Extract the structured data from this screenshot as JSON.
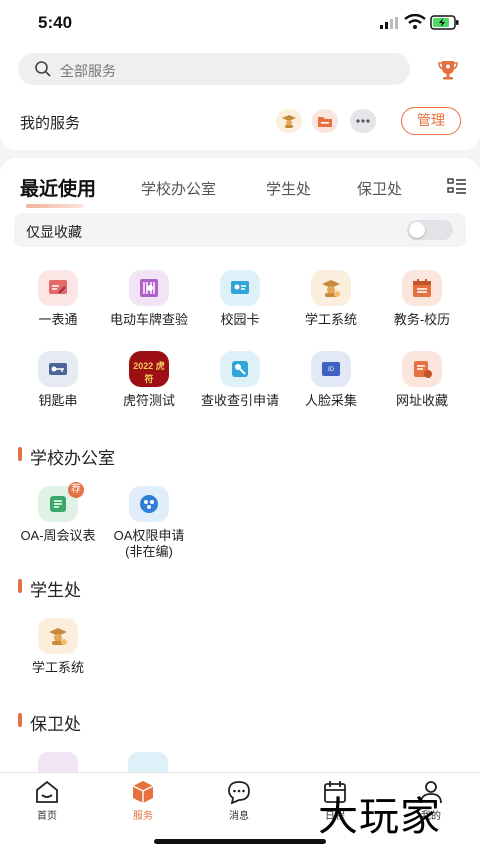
{
  "status_bar": {
    "time": "5:40"
  },
  "header": {
    "search_placeholder": "全部服务",
    "my_services_label": "我的服务",
    "manage_label": "管理"
  },
  "tabs": [
    {
      "label": "最近使用",
      "active": true
    },
    {
      "label": "学校办公室",
      "active": false
    },
    {
      "label": "学生处",
      "active": false
    },
    {
      "label": "保卫处",
      "active": false
    }
  ],
  "favorites_only": {
    "label": "仅显收藏",
    "enabled": false
  },
  "recent_apps": [
    {
      "name": "一表通",
      "icon": "form-icon"
    },
    {
      "name": "电动车牌查验",
      "icon": "plate-icon"
    },
    {
      "name": "校园卡",
      "icon": "card-icon"
    },
    {
      "name": "学工系统",
      "icon": "graduate-icon"
    },
    {
      "name": "教务-校历",
      "icon": "calendar-icon"
    },
    {
      "name": "钥匙串",
      "icon": "key-icon"
    },
    {
      "name": "虎符测试",
      "icon": "tiger-tally-icon",
      "image_text": "2022 虎符"
    },
    {
      "name": "查收查引申请",
      "icon": "search-doc-icon"
    },
    {
      "name": "人脸采集",
      "icon": "face-icon"
    },
    {
      "name": "网址收藏",
      "icon": "bookmark-icon"
    }
  ],
  "sections": [
    {
      "title": "学校办公室",
      "apps": [
        {
          "name": "OA-周会议表",
          "icon": "meeting-icon",
          "badge": "荐"
        },
        {
          "name": "OA权限申请(非在编)",
          "icon": "permission-icon"
        }
      ]
    },
    {
      "title": "学生处",
      "apps": [
        {
          "name": "学工系统",
          "icon": "graduate-icon"
        }
      ]
    },
    {
      "title": "保卫处",
      "apps": []
    }
  ],
  "nav": [
    {
      "label": "首页",
      "icon": "home-icon",
      "active": false
    },
    {
      "label": "服务",
      "icon": "service-box-icon",
      "active": true
    },
    {
      "label": "消息",
      "icon": "message-icon",
      "active": false
    },
    {
      "label": "日程",
      "icon": "calendar-icon",
      "active": false
    },
    {
      "label": "我的",
      "icon": "user-icon",
      "active": false
    }
  ],
  "watermark": "大玩家",
  "colors": {
    "accent": "#e4713f",
    "background": "#f4f4f6"
  }
}
